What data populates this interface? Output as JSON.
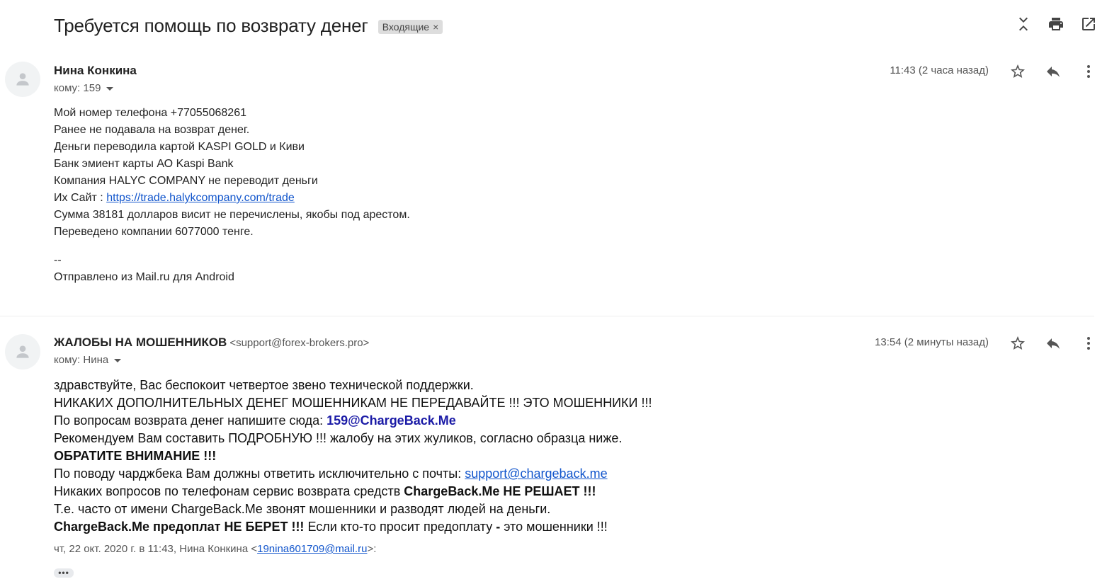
{
  "thread": {
    "subject": "Требуется помощь по возврату денег",
    "label": "Входящие",
    "label_remove": "×"
  },
  "messages": [
    {
      "sender": "Нина Конкина",
      "sender_email": "",
      "to": "кому: 159",
      "time": "11:43 (2 часа назад)",
      "body": {
        "l1": "Мой номер телефона +77055068261",
        "l2": "Ранее не подавала на возврат денег.",
        "l3": "Деньги переводила картой KASPI GOLD и Киви",
        "l4": "Банк эмиент карты АО Kaspi Bank",
        "l5": "Компания HALYC COMPANY не переводит деньги",
        "l6_prefix": "Их Сайт : ",
        "l6_link": "https://trade.halykcompany.com/trade",
        "l7": "Сумма 38181 долларов висит не перечислены, якобы под арестом.",
        "l8": "Переведено компании 6077000 тенге.",
        "sig_sep": "--",
        "sig": "Отправлено из Mail.ru для Android"
      }
    },
    {
      "sender": "ЖАЛОБЫ НА МОШЕННИКОВ",
      "sender_email": "<support@forex-brokers.pro>",
      "to": "кому: Нина",
      "time": "13:54 (2 минуты назад)",
      "body": {
        "l1": "здравствуйте, Вас беспокоит четвертое звено технической поддержки.",
        "l2": "НИКАКИХ ДОПОЛНИТЕЛЬНЫХ ДЕНЕГ МОШЕННИКАМ НЕ ПЕРЕДАВАЙТЕ !!! ЭТО МОШЕННИКИ !!!",
        "l3_prefix": "По вопросам возврата денег напишите сюда: ",
        "l3_link": "159@ChargeBack.Me",
        "l4": "Рекомендуем Вам составить ПОДРОБНУЮ !!! жалобу на этих жуликов, согласно образца ниже.",
        "l5": "ОБРАТИТЕ ВНИМАНИЕ !!!",
        "l6_prefix": "По поводу чарджбека Вам должны ответить исключительно с почты: ",
        "l6_link": "support@chargeback.me",
        "l7_prefix": "Никаких вопросов по телефонам сервис возврата средств ",
        "l7_bold": "ChargeBack.Me НЕ РЕШАЕТ !!!",
        "l8": "Т.е. часто от имени ChargeBack.Me звонят мошенники и разводят людей на деньги.",
        "l9_bold1": "ChargeBack.Me предоплат НЕ БЕРЕТ !!!",
        "l9_mid": " Если кто-то просит предоплату ",
        "l9_dash": "-",
        "l9_end": " это мошенники !!!"
      },
      "quote": {
        "prefix": "чт, 22 окт. 2020 г. в 11:43, Нина Конкина <",
        "email": "19nina601709@mail.ru",
        "suffix": ">:"
      },
      "expand": "•••"
    }
  ]
}
